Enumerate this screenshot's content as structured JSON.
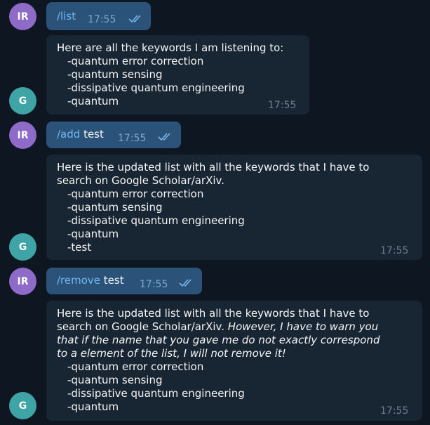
{
  "messages": [
    {
      "sender_initials": "IR",
      "command": "/list",
      "arg": "",
      "time": "17:55"
    },
    {
      "sender_initials": "G",
      "lines": [
        "Here are all the keywords I am listening to:"
      ],
      "keywords": [
        "-quantum error correction",
        "-quantum sensing",
        "-dissipative quantum engineering",
        "-quantum"
      ],
      "time": "17:55"
    },
    {
      "sender_initials": "IR",
      "command": "/add",
      "arg": " test",
      "time": "17:55"
    },
    {
      "sender_initials": "G",
      "lines": [
        "Here is the updated list with all the keywords that I have to",
        "search on Google Scholar/arXiv."
      ],
      "keywords": [
        "-quantum error correction",
        "-quantum sensing",
        "-dissipative quantum engineering",
        "-quantum",
        "-test"
      ],
      "time": "17:55"
    },
    {
      "sender_initials": "IR",
      "command": "/remove",
      "arg": " test",
      "time": "17:55"
    },
    {
      "sender_initials": "G",
      "lines": [
        "Here is the updated list with all the keywords that I have to",
        "search on Google Scholar/arXiv. "
      ],
      "warning": [
        "However, I have to warn you",
        "that if the name that you gave me do not exactly correspond",
        "to a element of the list, I will not remove it!"
      ],
      "keywords": [
        "-quantum error correction",
        "-quantum sensing",
        "-dissipative quantum engineering",
        "-quantum"
      ],
      "time": "17:55"
    }
  ],
  "colors": {
    "background": "#0e1621",
    "outgoing": "#2b5278",
    "incoming": "#182533",
    "command": "#70b6f0"
  },
  "icons": {
    "read_receipt": "double-check-icon"
  }
}
